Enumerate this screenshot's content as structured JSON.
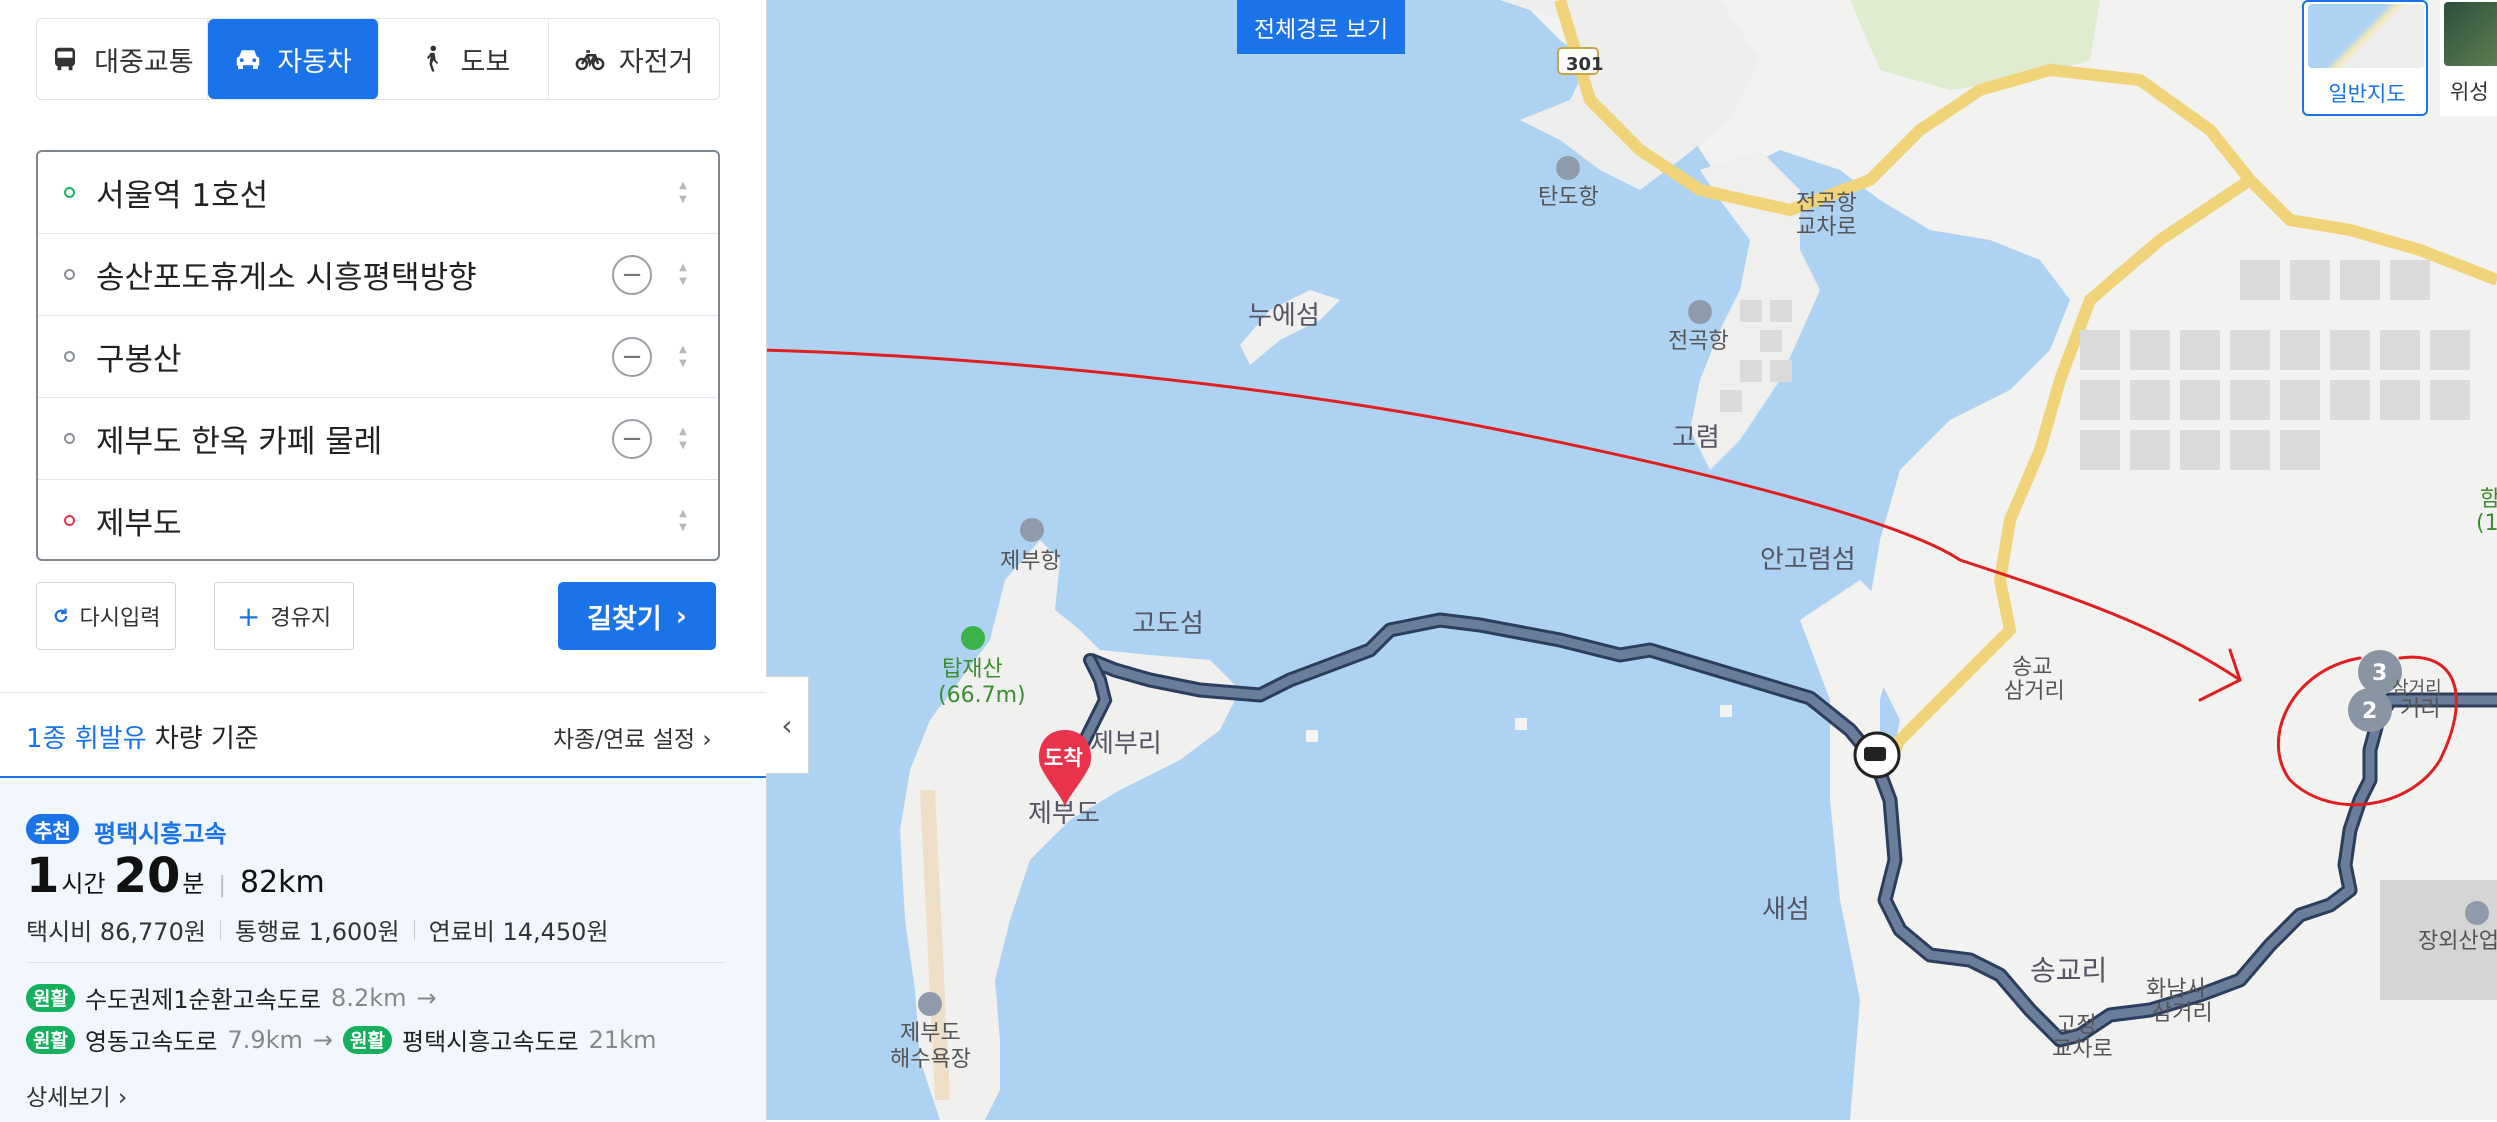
{
  "tabs": [
    {
      "label": "대중교통",
      "icon": "bus-icon",
      "active": false
    },
    {
      "label": "자동차",
      "icon": "car-icon",
      "active": true
    },
    {
      "label": "도보",
      "icon": "walk-icon",
      "active": false
    },
    {
      "label": "자전거",
      "icon": "bike-icon",
      "active": false
    }
  ],
  "stops": [
    {
      "label": "서울역 1호선",
      "kind": "start"
    },
    {
      "label": "송산포도휴게소 시흥평택방향",
      "kind": "via"
    },
    {
      "label": "구봉산",
      "kind": "via"
    },
    {
      "label": "제부도 한옥 카페 물레",
      "kind": "via"
    },
    {
      "label": "제부도",
      "kind": "end"
    }
  ],
  "actions": {
    "reset": "다시입력",
    "add_via": "경유지",
    "search": "길찾기"
  },
  "vehicle": {
    "type": "1종 휘발유",
    "suffix": "차량 기준",
    "settings": "차종/연료 설정"
  },
  "route": {
    "badge": "추천",
    "name": "평택시흥고속",
    "hours": "1",
    "hours_unit": "시간",
    "minutes": "20",
    "minutes_unit": "분",
    "distance": "82km",
    "taxi": "택시비 86,770원",
    "toll": "통행료 1,600원",
    "fuel": "연료비 14,450원",
    "roads_line1": [
      {
        "status": "원활",
        "name": "수도권제1순환고속도로",
        "km": "8.2km"
      }
    ],
    "roads_line2": [
      {
        "status": "원활",
        "name": "영동고속도로",
        "km": "7.9km"
      },
      {
        "status": "원활",
        "name": "평택시흥고속도로",
        "km": "21km"
      }
    ],
    "detail": "상세보기"
  },
  "map": {
    "full_route_button": "전체경로 보기",
    "map_types": [
      {
        "label": "일반지도",
        "active": true
      },
      {
        "label": "위성",
        "active": false
      }
    ],
    "labels": {
      "road_301": "301",
      "tando_port": "탄도항",
      "jeongok_port": "전곡항",
      "jeongok_ic_1": "전곡항",
      "jeongok_ic_2": "교차로",
      "nuesum": "누에섬",
      "goryeom": "고렴",
      "angoryeom": "안고렴섬",
      "jebu_port": "제부항",
      "tapjaesan": "탑재산",
      "tapjaesan_height": "(66.7m)",
      "godoseom": "고도섬",
      "jeburi": "제부리",
      "arrival": "도착",
      "jebudo": "제부도",
      "songgyo_1": "송교",
      "songgyo_2": "삼거리",
      "saeseom": "새섬",
      "songgyori": "송교리",
      "hwanam_1": "화남사",
      "hwanam_2": "삼거리",
      "gojeong_1": "고정",
      "gojeong_2": "교차로",
      "jangoe": "장외산업",
      "beach_1": "제부도",
      "beach_2": "해수욕장",
      "num_3": "3",
      "num_2": "2",
      "edge_1": "거리",
      "edge_2": "삼거리",
      "edge_3": "함",
      "edge_4": "(1"
    }
  },
  "colors": {
    "accent": "#1a73e8",
    "route_line": "#4a5c79",
    "water": "#aed3f2",
    "annotation": "#e02020"
  }
}
